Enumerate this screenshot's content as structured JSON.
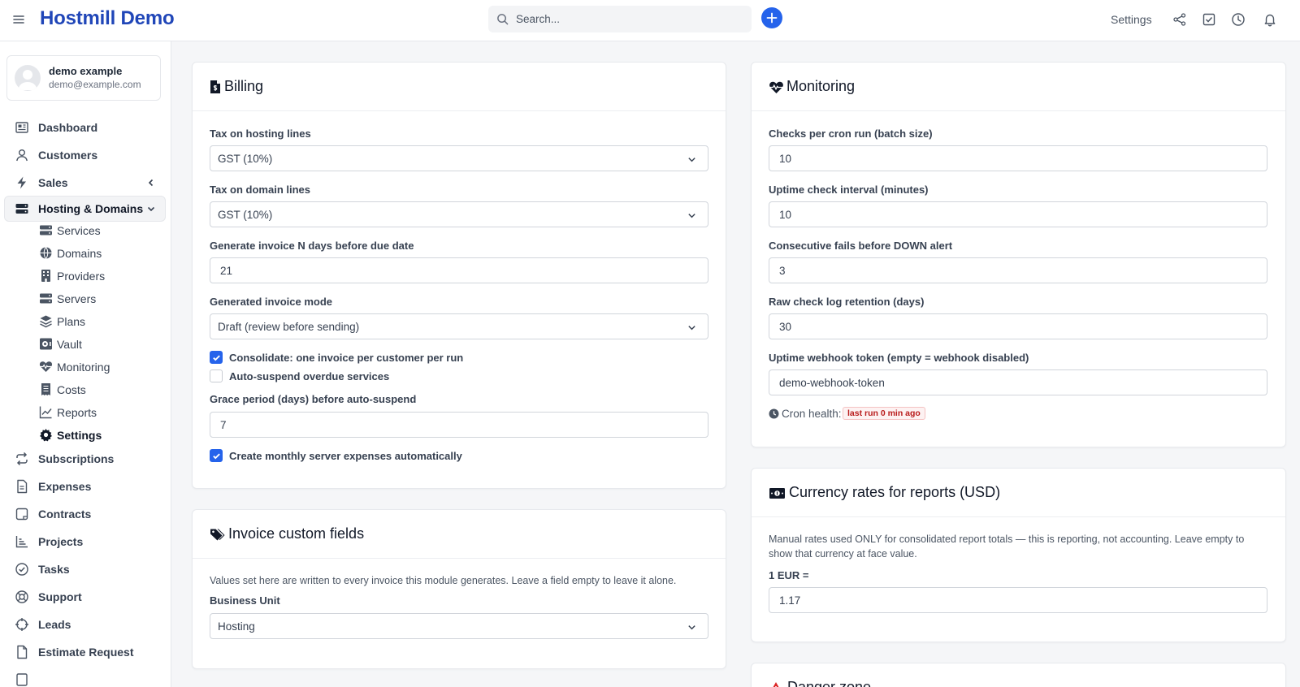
{
  "header": {
    "brand": "Hostmill Demo",
    "search_placeholder": "Search...",
    "settings_label": "Settings",
    "icons": [
      "menu-icon",
      "search-icon",
      "plus-icon",
      "share-icon",
      "checkbox-icon",
      "clock-icon",
      "bell-icon"
    ],
    "accent_color": "#2563eb",
    "brand_color": "#2046b8"
  },
  "profile": {
    "name": "demo example",
    "email": "demo@example.com"
  },
  "sidebar": {
    "items": [
      {
        "label": "Dashboard",
        "icon": "dashboard-icon"
      },
      {
        "label": "Customers",
        "icon": "user-icon"
      },
      {
        "label": "Sales",
        "icon": "bolt-icon"
      },
      {
        "label": "Hosting & Domains",
        "icon": "server-icon"
      },
      {
        "label": "Subscriptions",
        "icon": "repeat-icon"
      },
      {
        "label": "Expenses",
        "icon": "file-icon"
      },
      {
        "label": "Contracts",
        "icon": "contract-icon"
      },
      {
        "label": "Projects",
        "icon": "chart-icon"
      },
      {
        "label": "Tasks",
        "icon": "check-circle-icon"
      },
      {
        "label": "Support",
        "icon": "lifebuoy-icon"
      },
      {
        "label": "Leads",
        "icon": "crosshair-icon"
      },
      {
        "label": "Estimate Request",
        "icon": "document-icon"
      }
    ],
    "sub_items": [
      {
        "label": "Services",
        "icon": "server-icon"
      },
      {
        "label": "Domains",
        "icon": "globe-icon"
      },
      {
        "label": "Providers",
        "icon": "building-icon"
      },
      {
        "label": "Servers",
        "icon": "server-icon"
      },
      {
        "label": "Plans",
        "icon": "layers-icon"
      },
      {
        "label": "Vault",
        "icon": "vault-icon"
      },
      {
        "label": "Monitoring",
        "icon": "heartbeat-icon"
      },
      {
        "label": "Costs",
        "icon": "receipt-icon"
      },
      {
        "label": "Reports",
        "icon": "line-chart-icon"
      },
      {
        "label": "Settings",
        "icon": "gear-icon"
      }
    ]
  },
  "billing": {
    "title": "Billing",
    "tax_hosting_label": "Tax on hosting lines",
    "tax_hosting_value": "GST (10%)",
    "tax_domain_label": "Tax on domain lines",
    "tax_domain_value": "GST (10%)",
    "days_before_label": "Generate invoice N days before due date",
    "days_before_value": "21",
    "mode_label": "Generated invoice mode",
    "mode_value": "Draft (review before sending)",
    "consolidate_label": "Consolidate: one invoice per customer per run",
    "consolidate_checked": true,
    "autosuspend_label": "Auto-suspend overdue services",
    "autosuspend_checked": false,
    "grace_label": "Grace period (days) before auto-suspend",
    "grace_value": "7",
    "monthly_expenses_label": "Create monthly server expenses automatically",
    "monthly_expenses_checked": true
  },
  "invoice_fields": {
    "title": "Invoice custom fields",
    "help": "Values set here are written to every invoice this module generates. Leave a field empty to leave it alone.",
    "business_unit_label": "Business Unit",
    "business_unit_value": "Hosting"
  },
  "monitoring": {
    "title": "Monitoring",
    "batch_label": "Checks per cron run (batch size)",
    "batch_value": "10",
    "interval_label": "Uptime check interval (minutes)",
    "interval_value": "10",
    "fails_label": "Consecutive fails before DOWN alert",
    "fails_value": "3",
    "retention_label": "Raw check log retention (days)",
    "retention_value": "30",
    "webhook_label": "Uptime webhook token (empty = webhook disabled)",
    "webhook_value": "demo-webhook-token",
    "cron_label": "Cron health:",
    "cron_badge": "last run 0 min ago"
  },
  "currency": {
    "title": "Currency rates for reports (USD)",
    "help": "Manual rates used ONLY for consolidated report totals — this is reporting, not accounting. Leave empty to show that currency at face value.",
    "eur_label": "1 EUR =",
    "eur_value": "1.17"
  },
  "danger": {
    "title": "Danger zone"
  }
}
